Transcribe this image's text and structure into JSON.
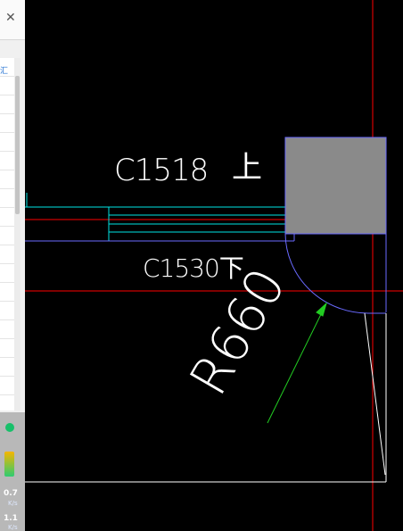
{
  "panel": {
    "close_label": "✕",
    "tag_text": "汇",
    "speed_up": "0.7",
    "speed_up_unit": "K/s",
    "speed_down": "1.1",
    "speed_down_unit": "K/s"
  },
  "drawing": {
    "label_c1518": "C1518",
    "label_up": "上",
    "label_c1530": "C1530下",
    "label_radius": "R660"
  },
  "colors": {
    "background": "#000000",
    "axis_red": "#ff0000",
    "wall_cyan": "#00e5e5",
    "arc_blue": "#6a6aff",
    "leader_green": "#22cc22",
    "column_gray": "#8a8a8a",
    "text_white": "#ffffff"
  }
}
